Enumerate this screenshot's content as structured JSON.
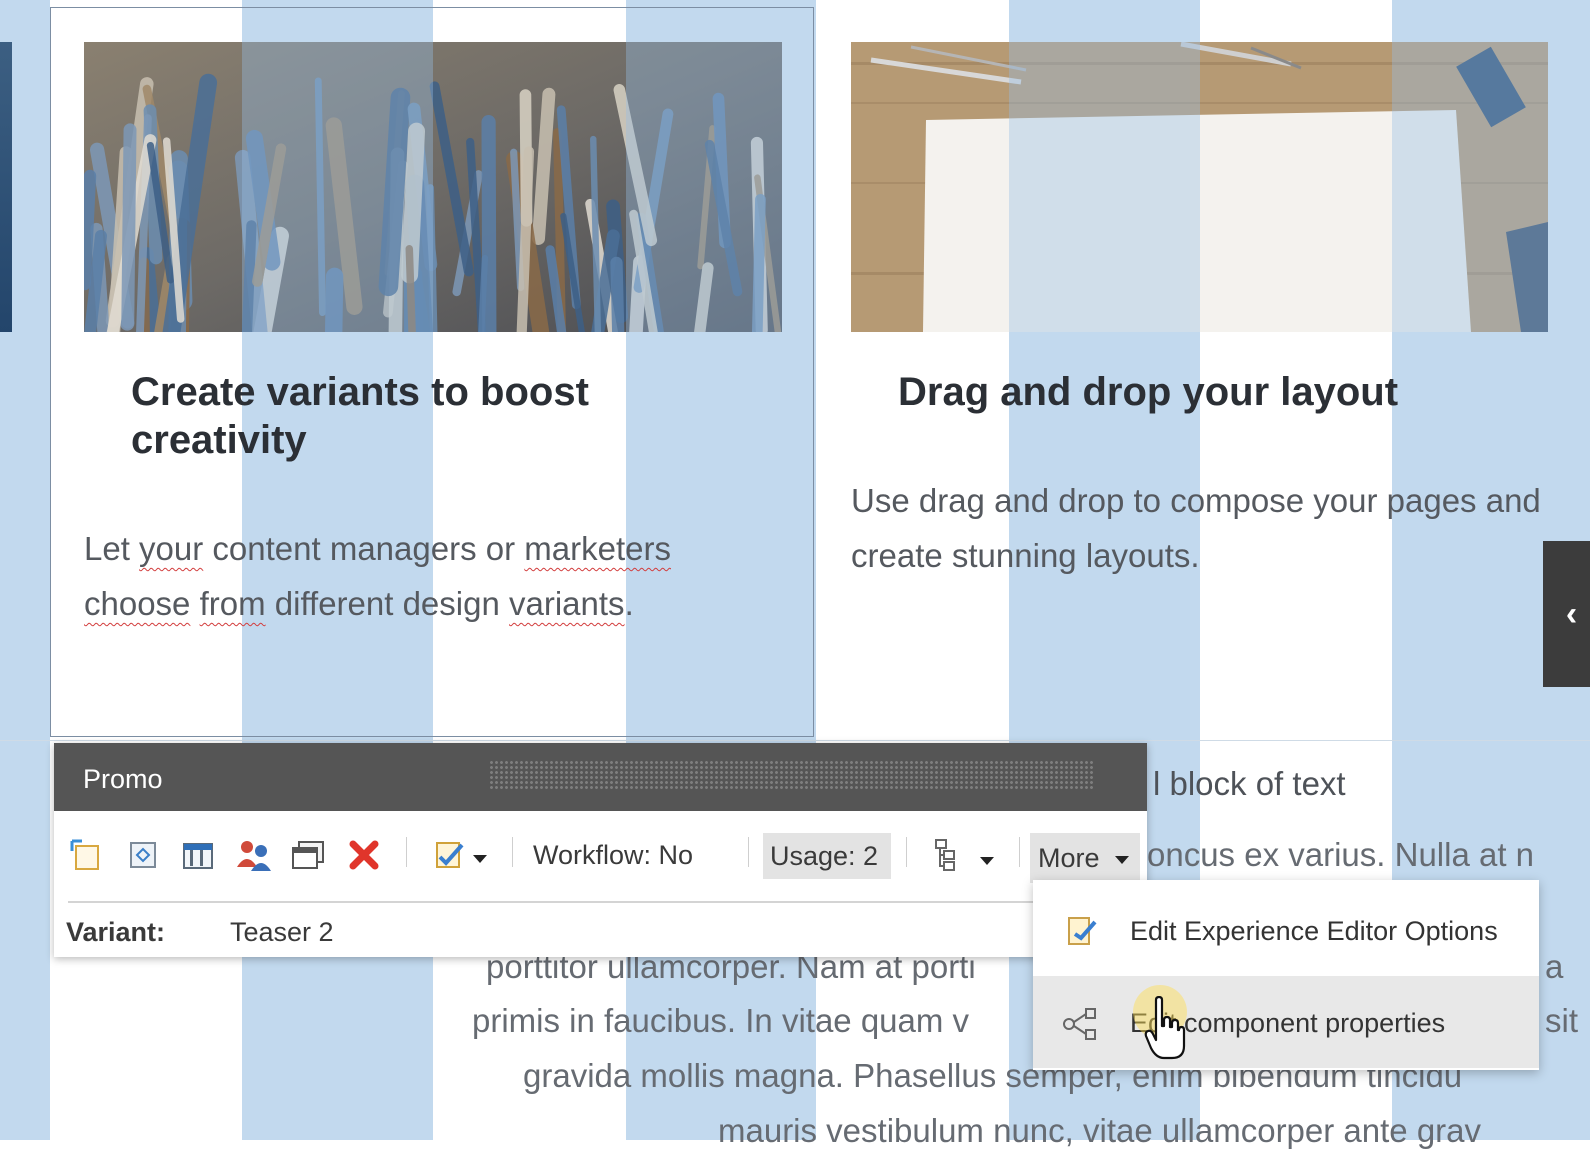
{
  "grid": {
    "color": "#c2d9ee"
  },
  "teasers": [
    {
      "title": "Create variants to boost creativity",
      "body_html": "Let <span class=\"sp\">your</span> content managers or <span class=\"sp\">marketers</span> <span class=\"sp\">choose</span> <span class=\"sp\">from</span> different design <span class=\"sp\">variants</span>.",
      "image_alt": "paintbrushes"
    },
    {
      "title": "Drag and drop your layout",
      "body": "Use drag and drop to compose your pages and create stunning layouts.",
      "image_alt": "desk with blank paper and pencils"
    }
  ],
  "background_text": {
    "heading_fragment": "l block of text",
    "line1": "oncus ex varius. Nulla at n",
    "line2_left": "porttitor ullamcorper. Nam at porti",
    "line2_right": "a",
    "line3_left": "primis in faucibus. In vitae quam v",
    "line3_right": "sit",
    "line4": "gravida mollis magna. Phasellus semper, enim bibendum tincidu",
    "line5": "mauris vestibulum nunc, vitae ullamcorper ante grav"
  },
  "chrome": {
    "title": "Promo",
    "toolbar_icons": [
      "select-parent-icon",
      "change-component-icon",
      "edit-variants-icon",
      "personalize-icon",
      "associated-content-icon",
      "remove-icon",
      "edit-field-icon",
      "component-tree-icon"
    ],
    "workflow_label": "Workflow: No",
    "usage_label": "Usage: 2",
    "more_label": "More",
    "variant_label": "Variant:",
    "variant_value": "Teaser 2"
  },
  "more_menu": {
    "items": [
      {
        "label": "Edit Experience Editor Options",
        "icon": "edit-options-icon"
      },
      {
        "label": "Edit component properties",
        "icon": "component-properties-icon",
        "hovered": true
      }
    ]
  },
  "side_tab": {
    "glyph": "‹"
  },
  "colors": {
    "chrome_header": "#555555",
    "remove_icon": "#e0352b",
    "grid_overlay": "#c2d9ee"
  }
}
